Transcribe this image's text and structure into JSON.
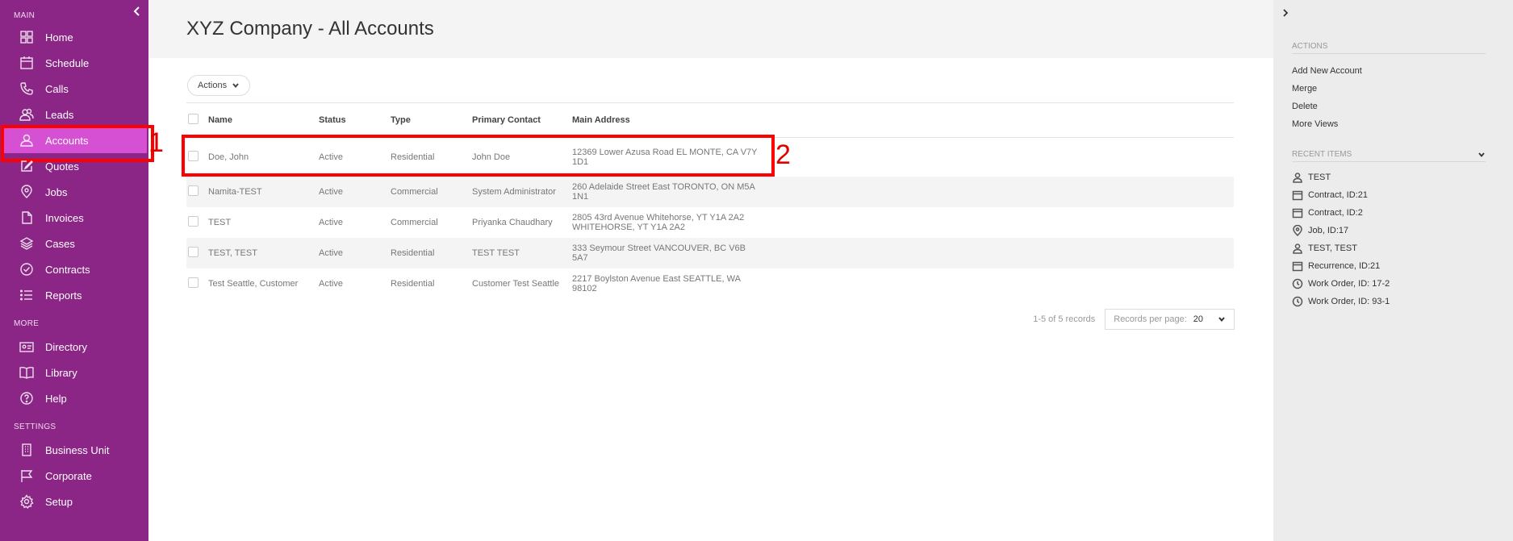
{
  "sidebar": {
    "sections": {
      "main": "MAIN",
      "more": "MORE",
      "settings": "SETTINGS"
    },
    "main_items": [
      {
        "label": "Home",
        "icon": "grid-icon"
      },
      {
        "label": "Schedule",
        "icon": "calendar-icon"
      },
      {
        "label": "Calls",
        "icon": "phone-icon"
      },
      {
        "label": "Leads",
        "icon": "people-icon"
      },
      {
        "label": "Accounts",
        "icon": "person-icon",
        "active": true
      },
      {
        "label": "Quotes",
        "icon": "edit-icon"
      },
      {
        "label": "Jobs",
        "icon": "location-pin-icon"
      },
      {
        "label": "Invoices",
        "icon": "document-icon"
      },
      {
        "label": "Cases",
        "icon": "layers-icon"
      },
      {
        "label": "Contracts",
        "icon": "check-circle-icon"
      },
      {
        "label": "Reports",
        "icon": "list-icon"
      }
    ],
    "more_items": [
      {
        "label": "Directory",
        "icon": "id-card-icon"
      },
      {
        "label": "Library",
        "icon": "book-icon"
      },
      {
        "label": "Help",
        "icon": "help-icon"
      }
    ],
    "settings_items": [
      {
        "label": "Business Unit",
        "icon": "building-icon"
      },
      {
        "label": "Corporate",
        "icon": "flag-icon"
      },
      {
        "label": "Setup",
        "icon": "gear-icon"
      }
    ]
  },
  "header": {
    "title": "XYZ Company - All Accounts"
  },
  "toolbar": {
    "actions_label": "Actions"
  },
  "table": {
    "columns": [
      "Name",
      "Status",
      "Type",
      "Primary Contact",
      "Main Address"
    ],
    "rows": [
      {
        "name": "Doe, John",
        "status": "Active",
        "type": "Residential",
        "contact": "John Doe",
        "address": "12369 Lower Azusa Road EL MONTE, CA V7Y 1D1"
      },
      {
        "name": "Namita-TEST",
        "status": "Active",
        "type": "Commercial",
        "contact": "System Administrator",
        "address": "260 Adelaide Street East TORONTO, ON M5A 1N1"
      },
      {
        "name": "TEST",
        "status": "Active",
        "type": "Commercial",
        "contact": "Priyanka Chaudhary",
        "address": "2805 43rd Avenue Whitehorse, YT Y1A 2A2 WHITEHORSE, YT Y1A 2A2"
      },
      {
        "name": "TEST, TEST",
        "status": "Active",
        "type": "Residential",
        "contact": "TEST TEST",
        "address": "333 Seymour Street VANCOUVER, BC V6B 5A7"
      },
      {
        "name": "Test Seattle, Customer",
        "status": "Active",
        "type": "Residential",
        "contact": "Customer Test Seattle",
        "address": "2217 Boylston Avenue East SEATTLE, WA 98102"
      }
    ]
  },
  "pager": {
    "summary": "1-5 of 5 records",
    "per_page_label": "Records per page:",
    "per_page_value": "20"
  },
  "annotations": {
    "label1": "1",
    "label2": "2"
  },
  "right_panel": {
    "actions_title": "ACTIONS",
    "actions": [
      "Add New Account",
      "Merge",
      "Delete",
      "More Views"
    ],
    "recent_title": "RECENT ITEMS",
    "recent": [
      {
        "label": "TEST",
        "icon": "person-icon"
      },
      {
        "label": "Contract, ID:21",
        "icon": "calendar-icon"
      },
      {
        "label": "Contract, ID:2",
        "icon": "calendar-icon"
      },
      {
        "label": "Job, ID:17",
        "icon": "location-pin-icon"
      },
      {
        "label": "TEST, TEST",
        "icon": "person-icon"
      },
      {
        "label": "Recurrence, ID:21",
        "icon": "calendar-icon"
      },
      {
        "label": "Work Order, ID: 17-2",
        "icon": "clock-icon"
      },
      {
        "label": "Work Order, ID: 93-1",
        "icon": "clock-icon"
      }
    ]
  },
  "colors": {
    "sidebar": "#8b2586",
    "active": "#d650d4",
    "highlight": "#ff0000"
  }
}
